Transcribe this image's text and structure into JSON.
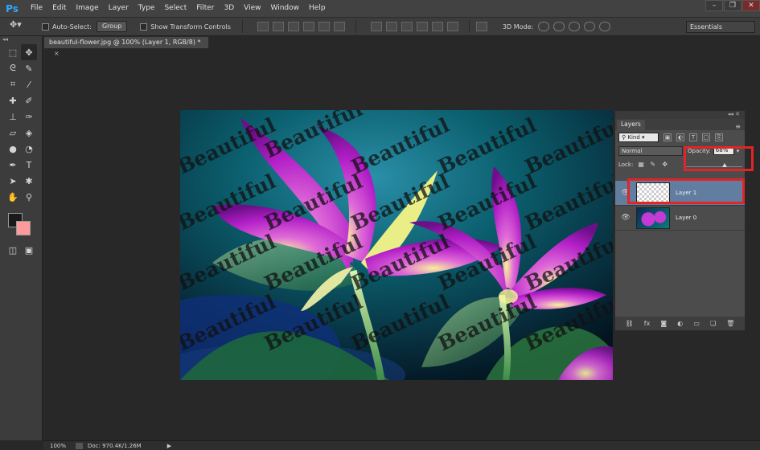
{
  "app": {
    "logo": "Ps"
  },
  "menubar": {
    "items": [
      "File",
      "Edit",
      "Image",
      "Layer",
      "Type",
      "Select",
      "Filter",
      "3D",
      "View",
      "Window",
      "Help"
    ]
  },
  "window_controls": {
    "minimize": "–",
    "restore": "❐",
    "close": "✕"
  },
  "options": {
    "auto_select_label": "Auto-Select:",
    "auto_select_value": "Group",
    "transform_label": "Show Transform Controls",
    "mode_3d_label": "3D Mode:",
    "workspace": "Essentials"
  },
  "document": {
    "tab_title": "beautiful-flower.jpg @ 100% (Layer 1, RGB/8) *",
    "close": "×"
  },
  "canvas": {
    "watermark_text": "Beautiful"
  },
  "status": {
    "zoom": "100%",
    "doc_info": "Doc: 970.4K/1.26M",
    "arrow": "▶"
  },
  "layers_panel": {
    "tab_label": "Layers",
    "filter_kind": "Kind",
    "blend_mode": "Normal",
    "opacity_label": "Opacity:",
    "opacity_value": "68%",
    "opacity_fraction": 0.68,
    "lock_label": "Lock:",
    "layers": [
      {
        "name": "Layer 1",
        "selected": true,
        "thumb": "transparent"
      },
      {
        "name": "Layer 0",
        "selected": false,
        "thumb": "flower"
      }
    ]
  },
  "colors": {
    "accent_red": "#e22426",
    "selection_blue": "#617da0",
    "background_swatch": "#ff9a9a"
  }
}
